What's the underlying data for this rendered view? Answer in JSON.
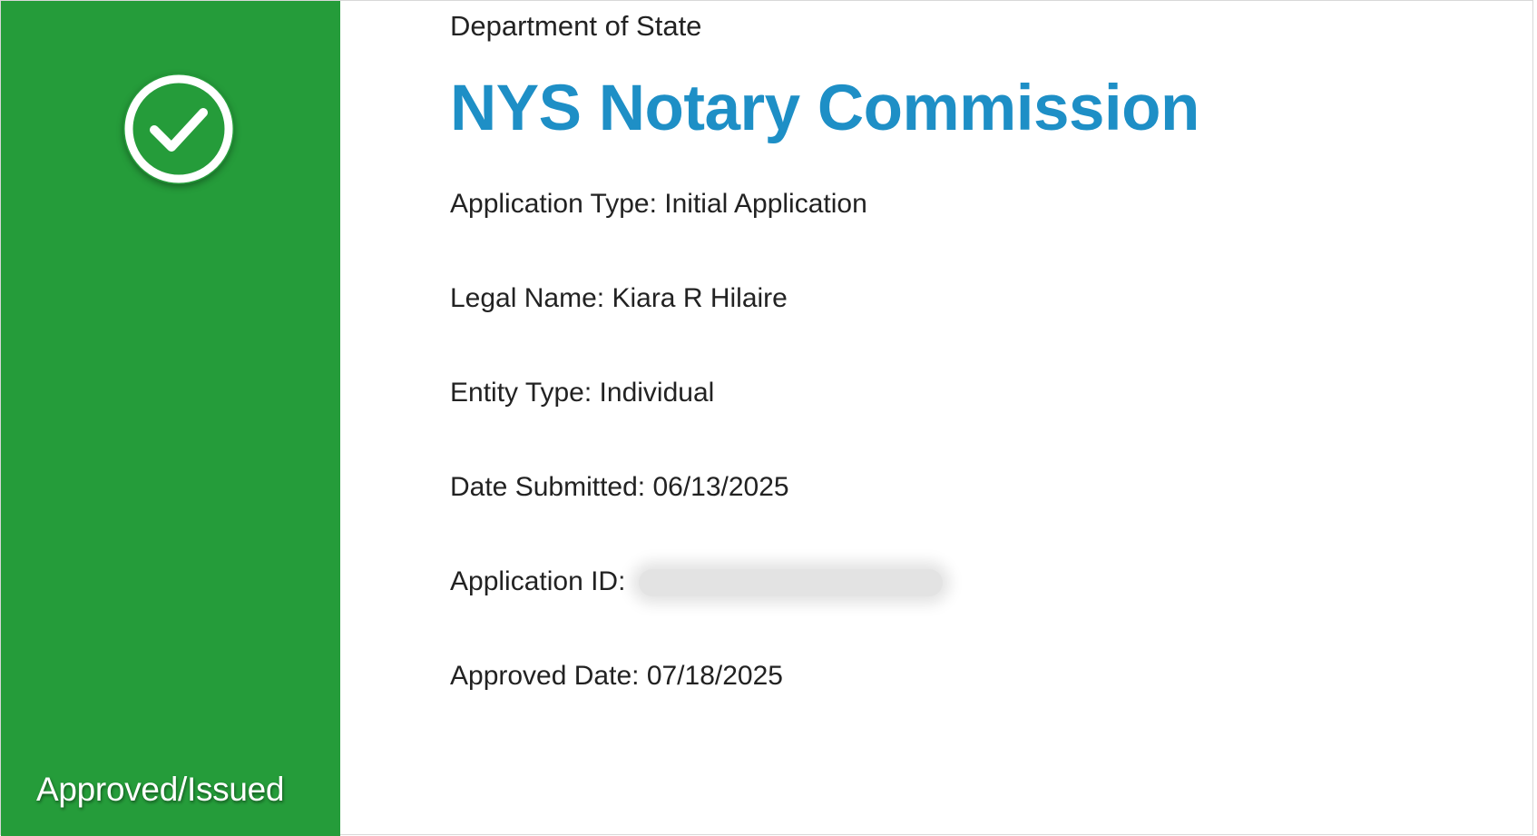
{
  "status_panel": {
    "status_label": "Approved/Issued",
    "icon": "check-circle-icon",
    "background_color": "#259c3a"
  },
  "header": {
    "department": "Department of State",
    "title": "NYS Notary Commission",
    "title_color": "#1e8fc6"
  },
  "details": {
    "application_type": {
      "label": "Application Type:",
      "value": "Initial Application"
    },
    "legal_name": {
      "label": "Legal Name:",
      "value": "Kiara R Hilaire"
    },
    "entity_type": {
      "label": "Entity Type:",
      "value": "Individual"
    },
    "date_submitted": {
      "label": "Date Submitted:",
      "value": "06/13/2025"
    },
    "application_id": {
      "label": "Application ID:"
    },
    "approved_date": {
      "label": "Approved Date:",
      "value": "07/18/2025"
    }
  }
}
